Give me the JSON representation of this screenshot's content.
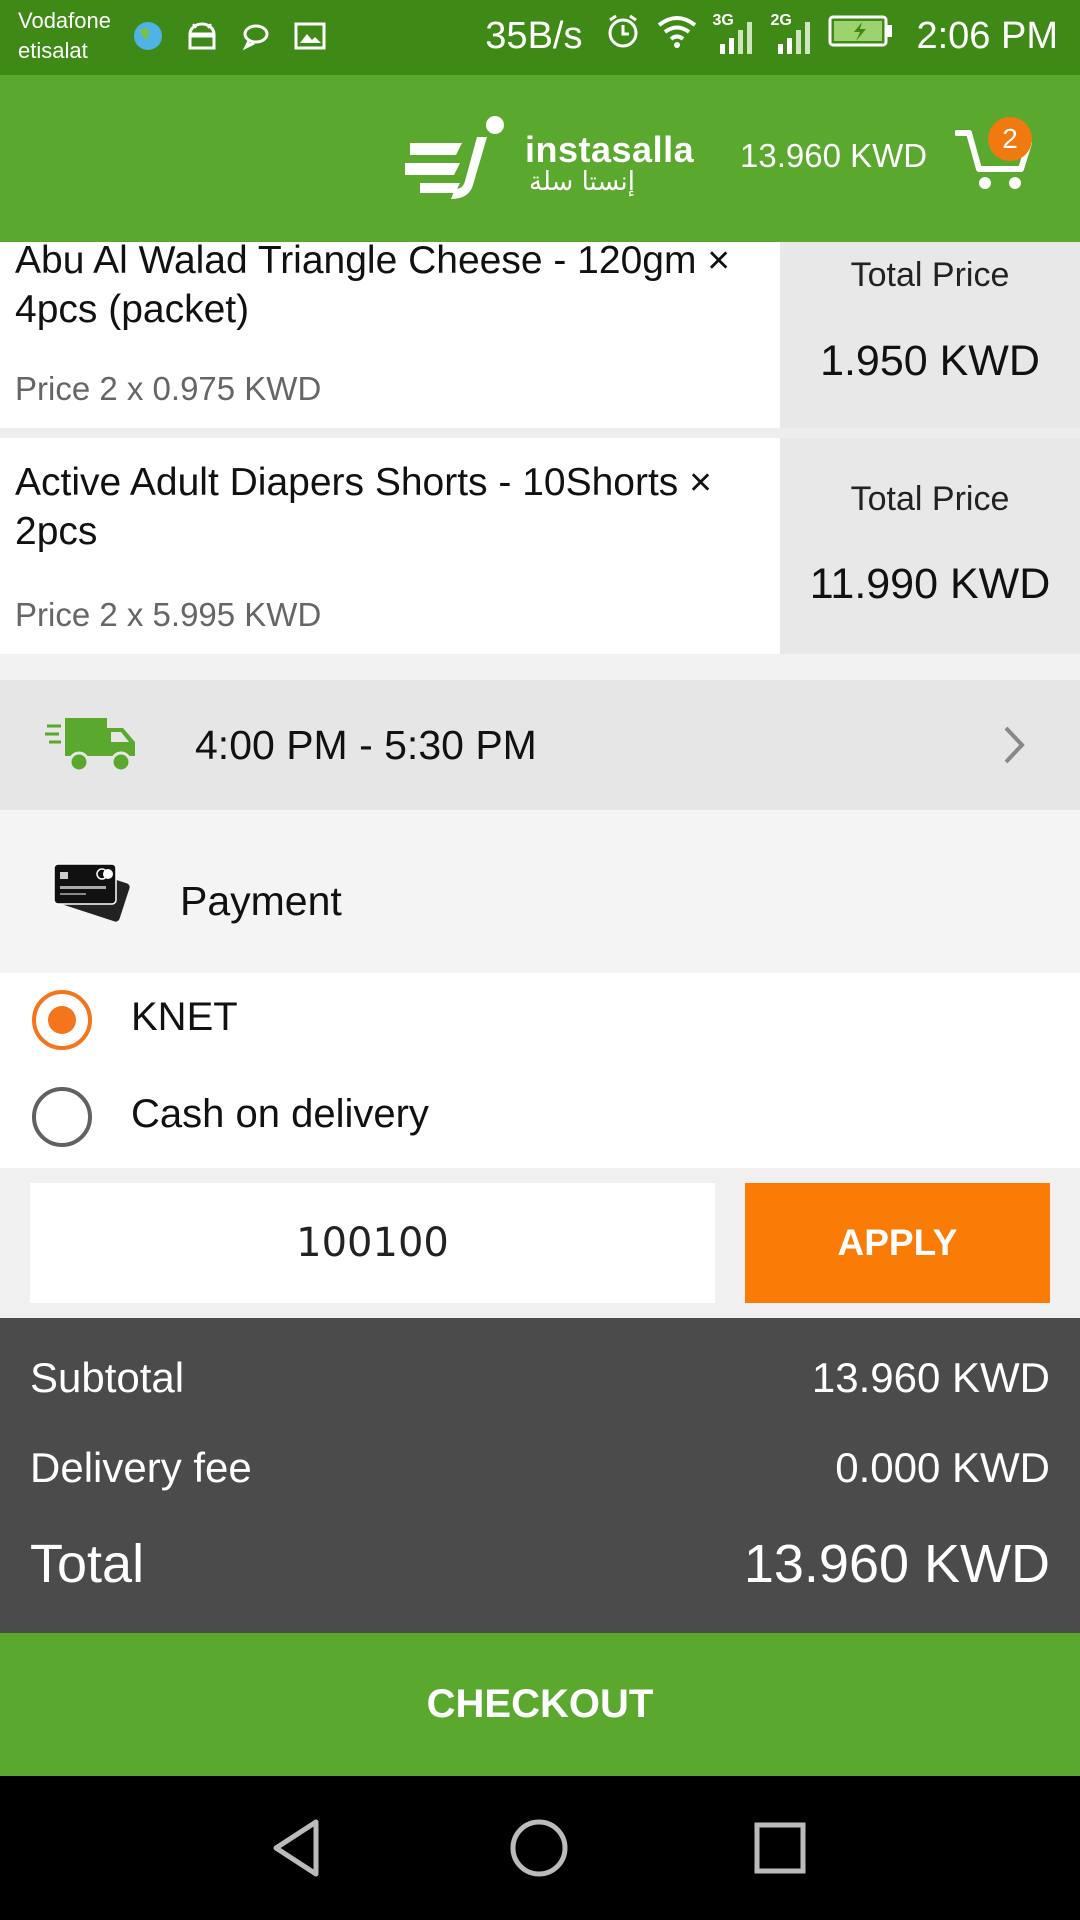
{
  "status_bar": {
    "carrier_line1": "Vodafone",
    "carrier_line2": "etisalat",
    "speed": "35B/s",
    "net_3g": "3G",
    "net_2g": "2G",
    "time": "2:06 PM"
  },
  "header": {
    "logo_text": "instasalla",
    "logo_text_ar": "إنستا سلة",
    "cart_total": "13.960 KWD",
    "cart_count": "2"
  },
  "items": [
    {
      "name": "Abu Al Walad Triangle Cheese - 120gm × 4pcs (packet)",
      "price": "Price 2 x 0.975  KWD",
      "total_label": "Total Price",
      "total_value": "1.950  KWD"
    },
    {
      "name": "Active Adult Diapers Shorts - 10Shorts × 2pcs",
      "price": "Price 2 x 5.995  KWD",
      "total_label": "Total Price",
      "total_value": "11.990  KWD"
    }
  ],
  "delivery": {
    "time_slot": "4:00 PM - 5:30 PM"
  },
  "payment": {
    "label": "Payment",
    "options": [
      {
        "label": "KNET",
        "selected": true
      },
      {
        "label": "Cash on delivery",
        "selected": false
      }
    ]
  },
  "coupon": {
    "value": "100100",
    "apply_label": "APPLY"
  },
  "totals": {
    "subtotal_label": "Subtotal",
    "subtotal_value": "13.960 KWD",
    "delivery_label": "Delivery fee",
    "delivery_value": "0.000 KWD",
    "total_label": "Total",
    "total_value": "13.960 KWD"
  },
  "checkout_label": "CHECKOUT",
  "colors": {
    "brand_green": "#5aa82e",
    "accent_orange": "#fa7b06",
    "totals_bg": "#4b4b4b"
  }
}
